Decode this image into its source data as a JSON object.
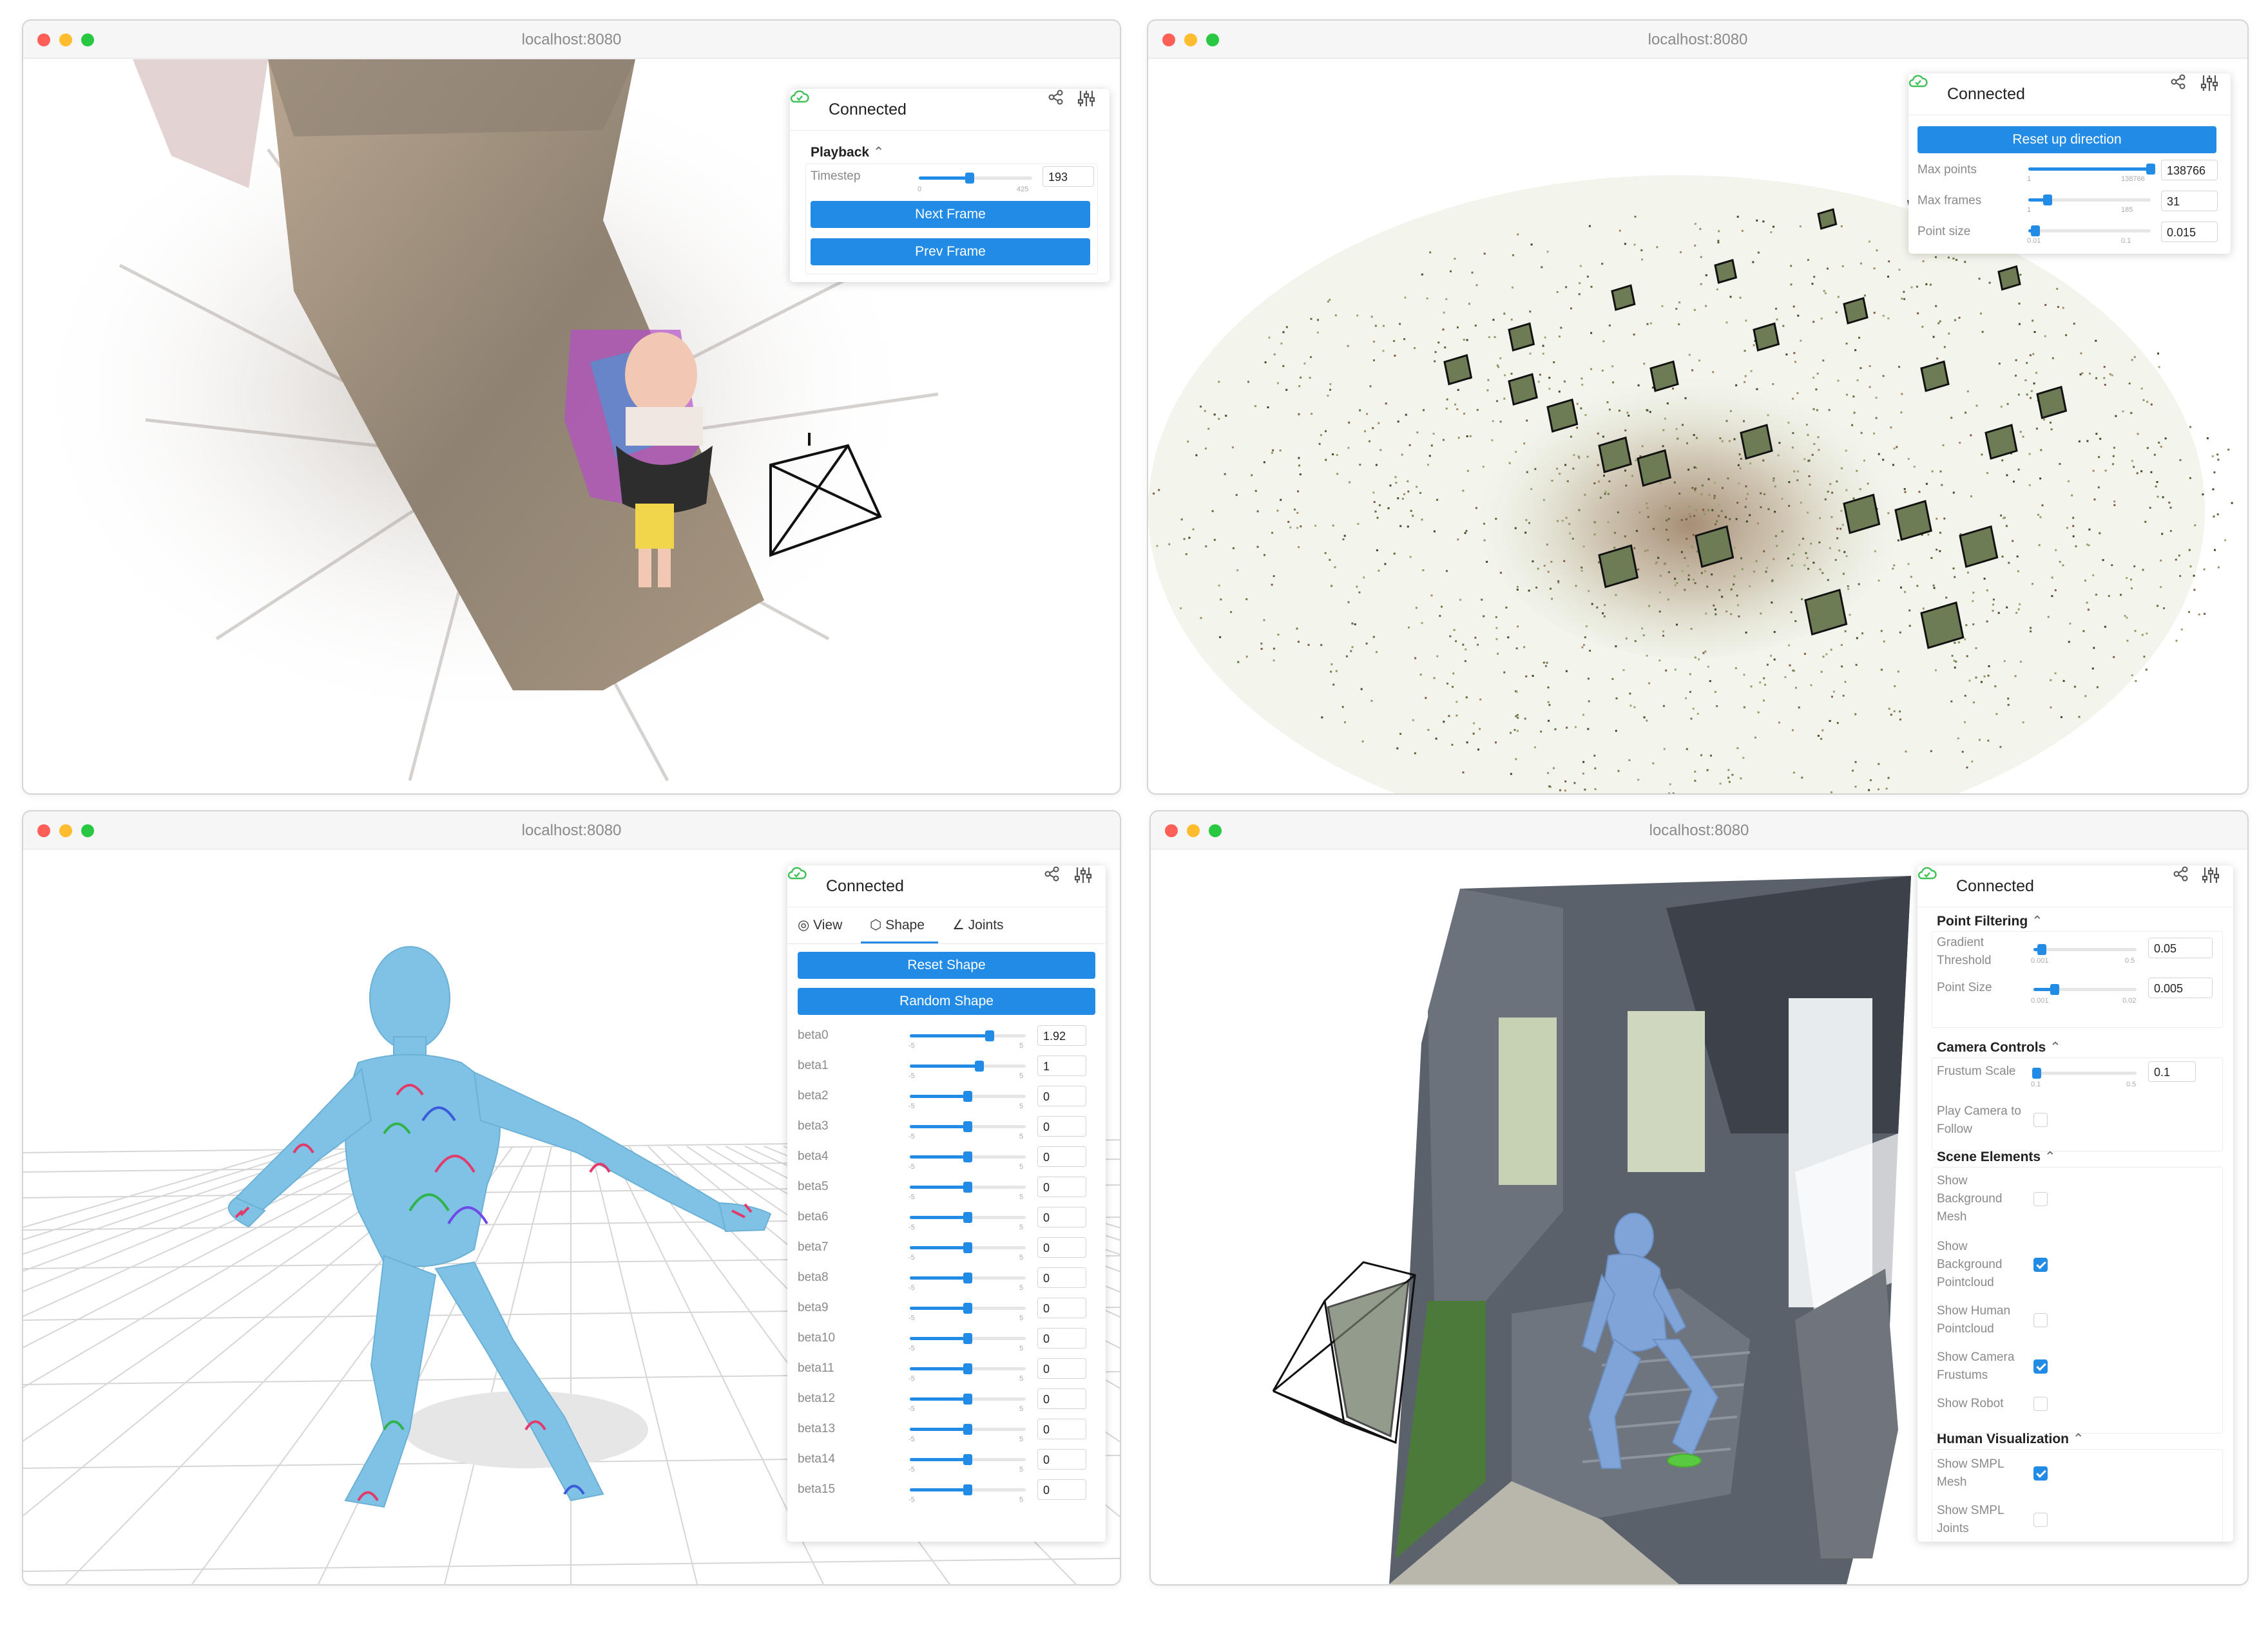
{
  "windows": {
    "w1": {
      "title": "localhost:8080",
      "panel": {
        "status": "Connected",
        "section": "Playback",
        "timestep_label": "Timestep",
        "timestep_value": "193",
        "timestep_min": "0",
        "timestep_max": "425",
        "timestep_fraction": 0.45,
        "next_label": "Next Frame",
        "prev_label": "Prev Frame"
      }
    },
    "w2": {
      "title": "localhost:8080",
      "panel": {
        "status": "Connected",
        "reset_label": "Reset up direction",
        "rows": [
          {
            "label": "Max points",
            "min": "1",
            "max": "138766",
            "value": "138766",
            "fraction": 1.0
          },
          {
            "label": "Max frames",
            "min": "1",
            "max": "185",
            "value": "31",
            "fraction": 0.16
          },
          {
            "label": "Point size",
            "min": "0.01",
            "max": "0.1",
            "value": "0.015",
            "fraction": 0.06
          }
        ]
      }
    },
    "w3": {
      "title": "localhost:8080",
      "panel": {
        "status": "Connected",
        "tabs": [
          "View",
          "Shape",
          "Joints"
        ],
        "active_tab": "Shape",
        "reset_label": "Reset Shape",
        "random_label": "Random Shape",
        "slider_min": "-5",
        "slider_max": "5",
        "betas": [
          {
            "label": "beta0",
            "value": "1.92",
            "fraction": 0.69
          },
          {
            "label": "beta1",
            "value": "1",
            "fraction": 0.6
          },
          {
            "label": "beta2",
            "value": "0",
            "fraction": 0.5
          },
          {
            "label": "beta3",
            "value": "0",
            "fraction": 0.5
          },
          {
            "label": "beta4",
            "value": "0",
            "fraction": 0.5
          },
          {
            "label": "beta5",
            "value": "0",
            "fraction": 0.5
          },
          {
            "label": "beta6",
            "value": "0",
            "fraction": 0.5
          },
          {
            "label": "beta7",
            "value": "0",
            "fraction": 0.5
          },
          {
            "label": "beta8",
            "value": "0",
            "fraction": 0.5
          },
          {
            "label": "beta9",
            "value": "0",
            "fraction": 0.5
          },
          {
            "label": "beta10",
            "value": "0",
            "fraction": 0.5
          },
          {
            "label": "beta11",
            "value": "0",
            "fraction": 0.5
          },
          {
            "label": "beta12",
            "value": "0",
            "fraction": 0.5
          },
          {
            "label": "beta13",
            "value": "0",
            "fraction": 0.5
          },
          {
            "label": "beta14",
            "value": "0",
            "fraction": 0.5
          },
          {
            "label": "beta15",
            "value": "0",
            "fraction": 0.5
          }
        ]
      }
    },
    "w4": {
      "title": "localhost:8080",
      "panel": {
        "status": "Connected",
        "point_filtering": {
          "title": "Point Filtering",
          "gradient_label_1": "Gradient",
          "gradient_label_2": "Threshold",
          "gradient_min": "0.001",
          "gradient_max": "0.5",
          "gradient_value": "0.05",
          "gradient_fraction": 0.08,
          "pointsize_label": "Point Size",
          "pointsize_min": "0.001",
          "pointsize_max": "0.02",
          "pointsize_value": "0.005",
          "pointsize_fraction": 0.2
        },
        "camera_controls": {
          "title": "Camera Controls",
          "frustum_label": "Frustum Scale",
          "frustum_min": "0.1",
          "frustum_max": "0.5",
          "frustum_value": "0.1",
          "frustum_fraction": 0.0,
          "play_label_1": "Play Camera to",
          "play_label_2": "Follow",
          "play_checked": false
        },
        "scene_elements": {
          "title": "Scene Elements",
          "items": [
            {
              "lines": [
                "Show",
                "Background",
                "Mesh"
              ],
              "checked": false
            },
            {
              "lines": [
                "Show",
                "Background",
                "Pointcloud"
              ],
              "checked": true
            },
            {
              "lines": [
                "Show Human",
                "Pointcloud"
              ],
              "checked": false
            },
            {
              "lines": [
                "Show Camera",
                "Frustums"
              ],
              "checked": true
            },
            {
              "lines": [
                "Show Robot"
              ],
              "checked": false
            }
          ]
        },
        "human_visualization": {
          "title": "Human Visualization",
          "items": [
            {
              "lines": [
                "Show SMPL",
                "Mesh"
              ],
              "checked": true
            },
            {
              "lines": [
                "Show SMPL",
                "Joints"
              ],
              "checked": false
            }
          ]
        }
      }
    }
  },
  "colors": {
    "accent": "#228be6",
    "connected": "#40c057",
    "body": "#7fc2e6"
  }
}
